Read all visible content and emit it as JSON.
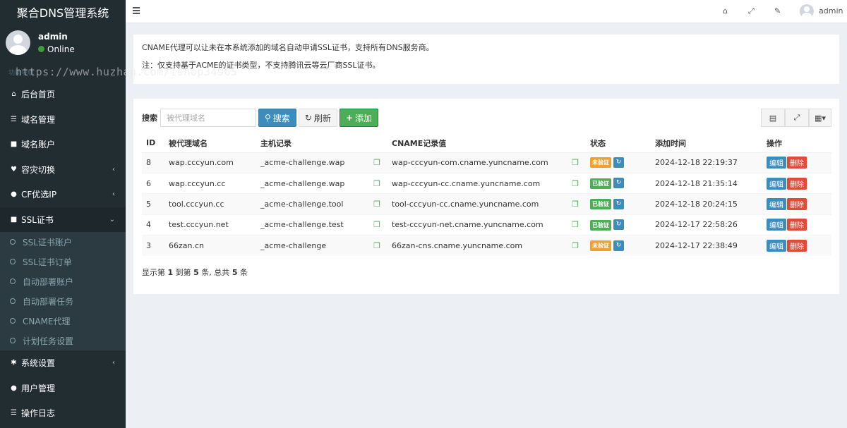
{
  "app": {
    "title": "聚合DNS管理系统"
  },
  "user": {
    "name": "admin",
    "status": "Online"
  },
  "sidebar": {
    "section_label": "功能导航",
    "watermark": "https://www.huzhan.com/ishop34965",
    "items": [
      {
        "label": "后台首页",
        "icon": "home-icon"
      },
      {
        "label": "域名管理",
        "icon": "list-icon"
      },
      {
        "label": "域名账户",
        "icon": "lock-icon"
      },
      {
        "label": "容灾切换",
        "icon": "heartbeat-icon"
      },
      {
        "label": "CF优选IP",
        "icon": "globe-icon"
      },
      {
        "label": "SSL证书",
        "icon": "lock-icon"
      }
    ],
    "ssl_subitems": [
      {
        "label": "SSL证书账户"
      },
      {
        "label": "SSL证书订单"
      },
      {
        "label": "自动部署账户"
      },
      {
        "label": "自动部署任务"
      },
      {
        "label": "CNAME代理"
      },
      {
        "label": "计划任务设置"
      }
    ],
    "bottom_items": [
      {
        "label": "系统设置",
        "icon": "cogs-icon"
      },
      {
        "label": "用户管理",
        "icon": "user-icon"
      },
      {
        "label": "操作日志",
        "icon": "list-icon"
      }
    ]
  },
  "topbar": {
    "user_name": "admin"
  },
  "notice": {
    "line1": "CNAME代理可以让未在本系统添加的域名自动申请SSL证书，支持所有DNS服务商。",
    "line2": "注：仅支持基于ACME的证书类型，不支持腾讯云等云厂商SSL证书。"
  },
  "toolbar": {
    "search_label": "搜索",
    "search_placeholder": "被代理域名",
    "search_button": "搜索",
    "refresh_button": "刷新",
    "add_button": "添加"
  },
  "table": {
    "headers": [
      "ID",
      "被代理域名",
      "主机记录",
      "CNAME记录值",
      "状态",
      "添加时间",
      "操作"
    ],
    "rows": [
      {
        "id": "8",
        "domain": "wap.cccyun.com",
        "host": "_acme-challenge.wap",
        "cname": "wap-cccyun-com.cname.yuncname.com",
        "status": "未验证",
        "status_type": "warn",
        "time": "2024-12-18 22:19:37"
      },
      {
        "id": "6",
        "domain": "wap.cccyun.cc",
        "host": "_acme-challenge.wap",
        "cname": "wap-cccyun-cc.cname.yuncname.com",
        "status": "已验证",
        "status_type": "ok",
        "time": "2024-12-18 21:35:14"
      },
      {
        "id": "5",
        "domain": "tool.cccyun.cc",
        "host": "_acme-challenge.tool",
        "cname": "tool-cccyun-cc.cname.yuncname.com",
        "status": "已验证",
        "status_type": "ok",
        "time": "2024-12-18 20:24:15"
      },
      {
        "id": "4",
        "domain": "test.cccyun.net",
        "host": "_acme-challenge.test",
        "cname": "test-cccyun-net.cname.yuncname.com",
        "status": "已验证",
        "status_type": "ok",
        "time": "2024-12-17 22:58:26"
      },
      {
        "id": "3",
        "domain": "66zan.cn",
        "host": "_acme-challenge",
        "cname": "66zan-cns.cname.yuncname.com",
        "status": "未验证",
        "status_type": "warn",
        "time": "2024-12-17 22:38:49"
      }
    ],
    "edit_label": "编辑",
    "delete_label": "删除"
  },
  "pager": {
    "prefix": "显示第 ",
    "from": "1",
    "mid1": " 到第 ",
    "to": "5",
    "mid2": " 条, 总共 ",
    "total": "5",
    "suffix": " 条"
  }
}
